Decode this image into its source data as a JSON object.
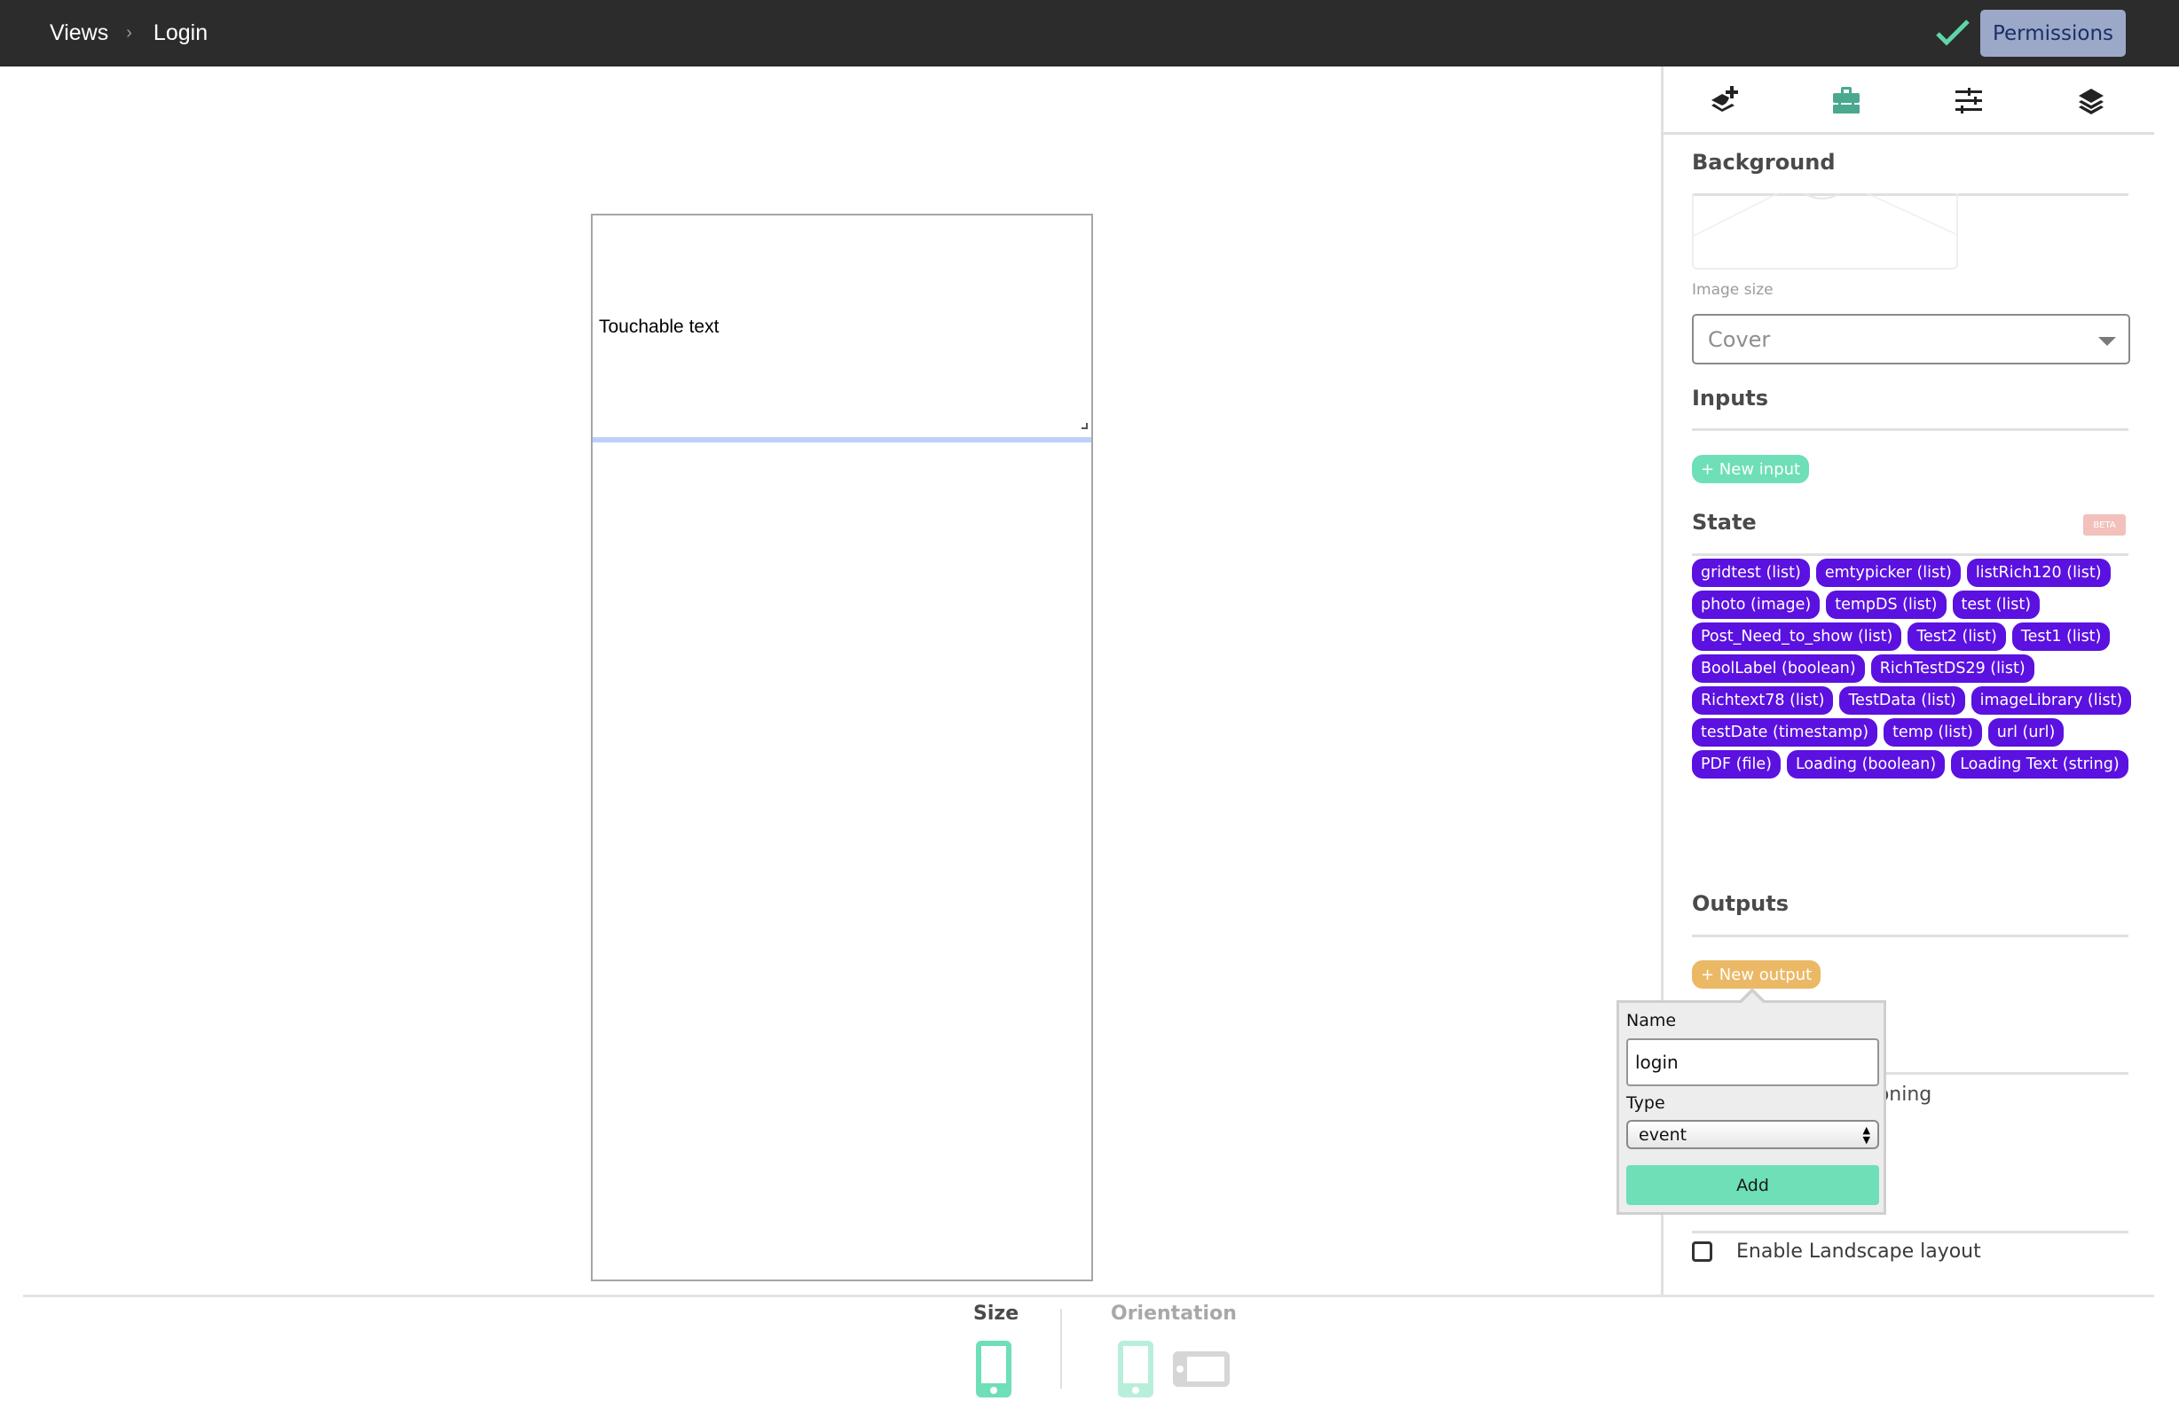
{
  "header": {
    "breadcrumb": [
      "Views",
      "Login"
    ],
    "breadcrumb_separator": "›",
    "status_icon": "check-icon",
    "permissions_label": "Permissions"
  },
  "canvas": {
    "component_text": "Touchable text"
  },
  "sidebar": {
    "tabs": [
      {
        "icon": "layers-plus-icon",
        "active": false
      },
      {
        "icon": "toolbox-icon",
        "active": true
      },
      {
        "icon": "sliders-icon",
        "active": false
      },
      {
        "icon": "layers-icon",
        "active": false
      }
    ],
    "background": {
      "title": "Background",
      "image_size_label": "Image size",
      "image_size_value": "Cover"
    },
    "inputs": {
      "title": "Inputs",
      "new_label": "+ New input"
    },
    "state": {
      "title": "State",
      "badge": "BETA",
      "items": [
        "gridtest (list)",
        "emtypicker (list)",
        "listRich120 (list)",
        "photo (image)",
        "tempDS (list)",
        "test (list)",
        "Post_Need_to_show (list)",
        "Test2 (list)",
        "Test1 (list)",
        "BoolLabel (boolean)",
        "RichTestDS29 (list)",
        "Richtext78 (list)",
        "TestData (list)",
        "imageLibrary (list)",
        "testDate (timestamp)",
        "temp (list)",
        "url (url)",
        "PDF (file)",
        "Loading (boolean)",
        "Loading Text (string)"
      ]
    },
    "outputs": {
      "title": "Outputs",
      "new_label": "+ New output"
    },
    "positioning_partial": "itioning",
    "landscape_label": "Enable Landscape layout",
    "landscape_checked": false
  },
  "popover": {
    "name_label": "Name",
    "name_value": "login",
    "type_label": "Type",
    "type_value": "event",
    "add_label": "Add"
  },
  "bottom": {
    "size_label": "Size",
    "orientation_label": "Orientation"
  },
  "colors": {
    "accent_green": "#6edfb7",
    "state_chip": "#5b11e0",
    "output_orange": "#ebb865",
    "header_bg": "#2c2c2c",
    "permissions_bg": "#9ba8c8",
    "beta_bg": "#f2c1bc"
  }
}
